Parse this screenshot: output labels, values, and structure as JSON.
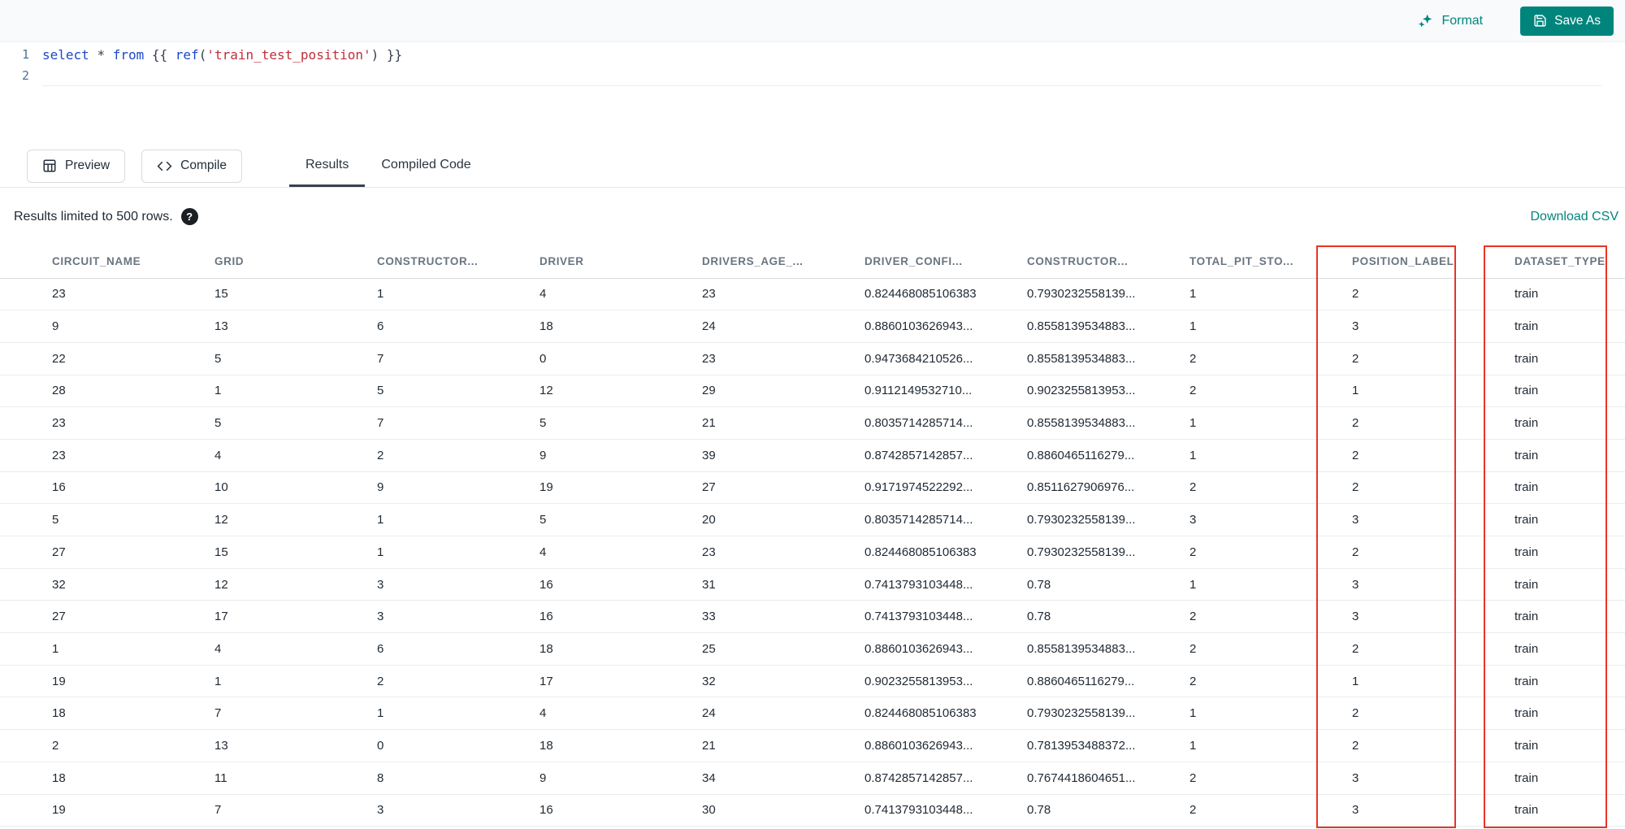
{
  "colors": {
    "teal": "#00857C",
    "annotation_red": "#EA3323",
    "keyword_blue": "#1A49C8",
    "string_red": "#C02F3A"
  },
  "toolbar": {
    "format_label": "Format",
    "save_as_label": "Save As"
  },
  "editor": {
    "lines": [
      {
        "number": "1"
      },
      {
        "number": "2"
      }
    ],
    "tokens": [
      {
        "text": "select",
        "type": "keyword"
      },
      {
        "text": " ",
        "type": "plain"
      },
      {
        "text": "*",
        "type": "operator"
      },
      {
        "text": " ",
        "type": "plain"
      },
      {
        "text": "from",
        "type": "keyword"
      },
      {
        "text": " {{ ",
        "type": "plain"
      },
      {
        "text": "ref",
        "type": "function"
      },
      {
        "text": "(",
        "type": "plain"
      },
      {
        "text": "'train_test_position'",
        "type": "string"
      },
      {
        "text": ")",
        "type": "plain"
      },
      {
        "text": " }}",
        "type": "plain"
      }
    ]
  },
  "actions": {
    "preview_label": "Preview",
    "compile_label": "Compile"
  },
  "tabs": [
    {
      "label": "Results",
      "active": true
    },
    {
      "label": "Compiled Code",
      "active": false
    }
  ],
  "results_bar": {
    "info_text": "Results limited to 500 rows.",
    "download_label": "Download CSV"
  },
  "table": {
    "columns": [
      "CIRCUIT_NAME",
      "GRID",
      "CONSTRUCTOR...",
      "DRIVER",
      "DRIVERS_AGE_...",
      "DRIVER_CONFI...",
      "CONSTRUCTOR...",
      "TOTAL_PIT_STO...",
      "POSITION_LABEL",
      "DATASET_TYPE"
    ],
    "highlighted_columns": [
      "POSITION_LABEL",
      "DATASET_TYPE"
    ],
    "rows": [
      [
        "23",
        "15",
        "1",
        "4",
        "23",
        "0.824468085106383",
        "0.7930232558139...",
        "1",
        "2",
        "train"
      ],
      [
        "9",
        "13",
        "6",
        "18",
        "24",
        "0.8860103626943...",
        "0.8558139534883...",
        "1",
        "3",
        "train"
      ],
      [
        "22",
        "5",
        "7",
        "0",
        "23",
        "0.9473684210526...",
        "0.8558139534883...",
        "2",
        "2",
        "train"
      ],
      [
        "28",
        "1",
        "5",
        "12",
        "29",
        "0.9112149532710...",
        "0.9023255813953...",
        "2",
        "1",
        "train"
      ],
      [
        "23",
        "5",
        "7",
        "5",
        "21",
        "0.8035714285714...",
        "0.8558139534883...",
        "1",
        "2",
        "train"
      ],
      [
        "23",
        "4",
        "2",
        "9",
        "39",
        "0.8742857142857...",
        "0.8860465116279...",
        "1",
        "2",
        "train"
      ],
      [
        "16",
        "10",
        "9",
        "19",
        "27",
        "0.9171974522292...",
        "0.8511627906976...",
        "2",
        "2",
        "train"
      ],
      [
        "5",
        "12",
        "1",
        "5",
        "20",
        "0.8035714285714...",
        "0.7930232558139...",
        "3",
        "3",
        "train"
      ],
      [
        "27",
        "15",
        "1",
        "4",
        "23",
        "0.824468085106383",
        "0.7930232558139...",
        "2",
        "2",
        "train"
      ],
      [
        "32",
        "12",
        "3",
        "16",
        "31",
        "0.7413793103448...",
        "0.78",
        "1",
        "3",
        "train"
      ],
      [
        "27",
        "17",
        "3",
        "16",
        "33",
        "0.7413793103448...",
        "0.78",
        "2",
        "3",
        "train"
      ],
      [
        "1",
        "4",
        "6",
        "18",
        "25",
        "0.8860103626943...",
        "0.8558139534883...",
        "2",
        "2",
        "train"
      ],
      [
        "19",
        "1",
        "2",
        "17",
        "32",
        "0.9023255813953...",
        "0.8860465116279...",
        "2",
        "1",
        "train"
      ],
      [
        "18",
        "7",
        "1",
        "4",
        "24",
        "0.824468085106383",
        "0.7930232558139...",
        "1",
        "2",
        "train"
      ],
      [
        "2",
        "13",
        "0",
        "18",
        "21",
        "0.8860103626943...",
        "0.7813953488372...",
        "1",
        "2",
        "train"
      ],
      [
        "18",
        "11",
        "8",
        "9",
        "34",
        "0.8742857142857...",
        "0.7674418604651...",
        "2",
        "3",
        "train"
      ],
      [
        "19",
        "7",
        "3",
        "16",
        "30",
        "0.7413793103448...",
        "0.78",
        "2",
        "3",
        "train"
      ]
    ]
  }
}
